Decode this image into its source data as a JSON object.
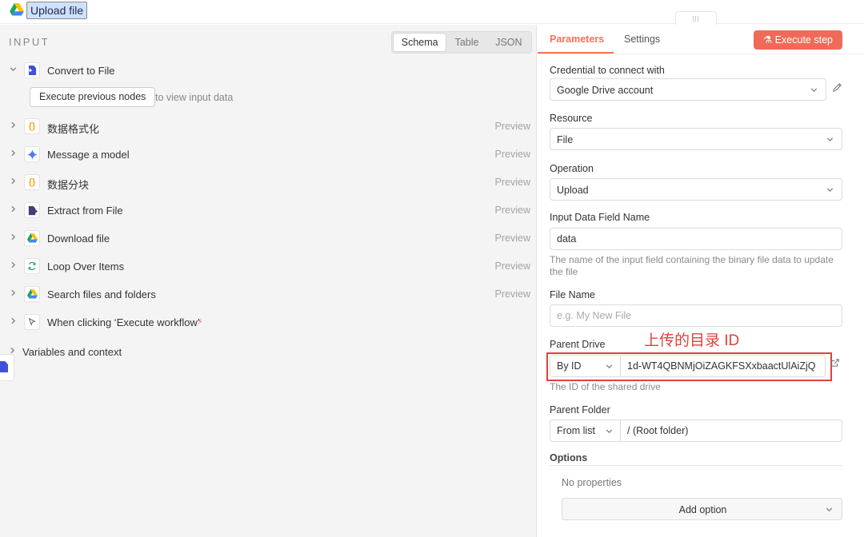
{
  "header": {
    "title": "Upload file",
    "drag_handle": "|||",
    "icon": "google-drive-icon"
  },
  "input_panel": {
    "title": "INPUT",
    "modes": [
      "Schema",
      "Table",
      "JSON"
    ],
    "active_mode": "Schema",
    "execute_previous_button": "Execute previous nodes",
    "execute_previous_hint": "to view input data",
    "nodes": [
      {
        "label": "Convert to File",
        "expanded": true,
        "icon": "convert-file-icon",
        "icon_color": "#3f51d8",
        "preview": ""
      },
      {
        "label": "数据格式化",
        "expanded": false,
        "icon": "code-braces-icon",
        "icon_color": "#f5a623",
        "preview": "Preview"
      },
      {
        "label": "Message a model",
        "expanded": false,
        "icon": "gemini-sparkle-icon",
        "icon_color": "#4a7ef5",
        "preview": "Preview"
      },
      {
        "label": "数据分块",
        "expanded": false,
        "icon": "code-braces-icon",
        "icon_color": "#f5a623",
        "preview": "Preview"
      },
      {
        "label": "Extract from File",
        "expanded": false,
        "icon": "extract-file-icon",
        "icon_color": "#3f3f7a",
        "preview": "Preview"
      },
      {
        "label": "Download file",
        "expanded": false,
        "icon": "google-drive-icon",
        "icon_color": "#1fa463",
        "preview": "Preview"
      },
      {
        "label": "Loop Over Items",
        "expanded": false,
        "icon": "loop-arrows-icon",
        "icon_color": "#2fa06a",
        "preview": "Preview"
      },
      {
        "label": "Search files and folders",
        "expanded": false,
        "icon": "google-drive-icon",
        "icon_color": "#1fa463",
        "preview": "Preview"
      },
      {
        "label": "When clicking ‘Execute workflow’",
        "expanded": false,
        "icon": "cursor-click-icon",
        "icon_color": "#666666",
        "preview": "",
        "trigger": true
      }
    ],
    "variables_label": "Variables and context"
  },
  "params_panel": {
    "tabs": [
      "Parameters",
      "Settings"
    ],
    "active_tab": "Parameters",
    "execute_step_button": "Execute step",
    "accent_color": "#ff6d5a",
    "credential": {
      "label": "Credential to connect with",
      "value": "Google Drive account"
    },
    "resource": {
      "label": "Resource",
      "value": "File"
    },
    "operation": {
      "label": "Operation",
      "value": "Upload"
    },
    "input_field": {
      "label": "Input Data Field Name",
      "value": "data",
      "hint": "The name of the input field containing the binary file data to update the file"
    },
    "file_name": {
      "label": "File Name",
      "placeholder": "e.g. My New File"
    },
    "annotation": "上传的目录 ID",
    "parent_drive": {
      "label": "Parent Drive",
      "mode": "By ID",
      "value": "1d-WT4QBNMjOiZAGKFSXxbaactUlAiZjQ",
      "hint": "The ID of the shared drive"
    },
    "parent_folder": {
      "label": "Parent Folder",
      "mode": "From list",
      "value": "/ (Root folder)"
    },
    "options": {
      "label": "Options",
      "empty_text": "No properties",
      "add_button": "Add option"
    }
  }
}
